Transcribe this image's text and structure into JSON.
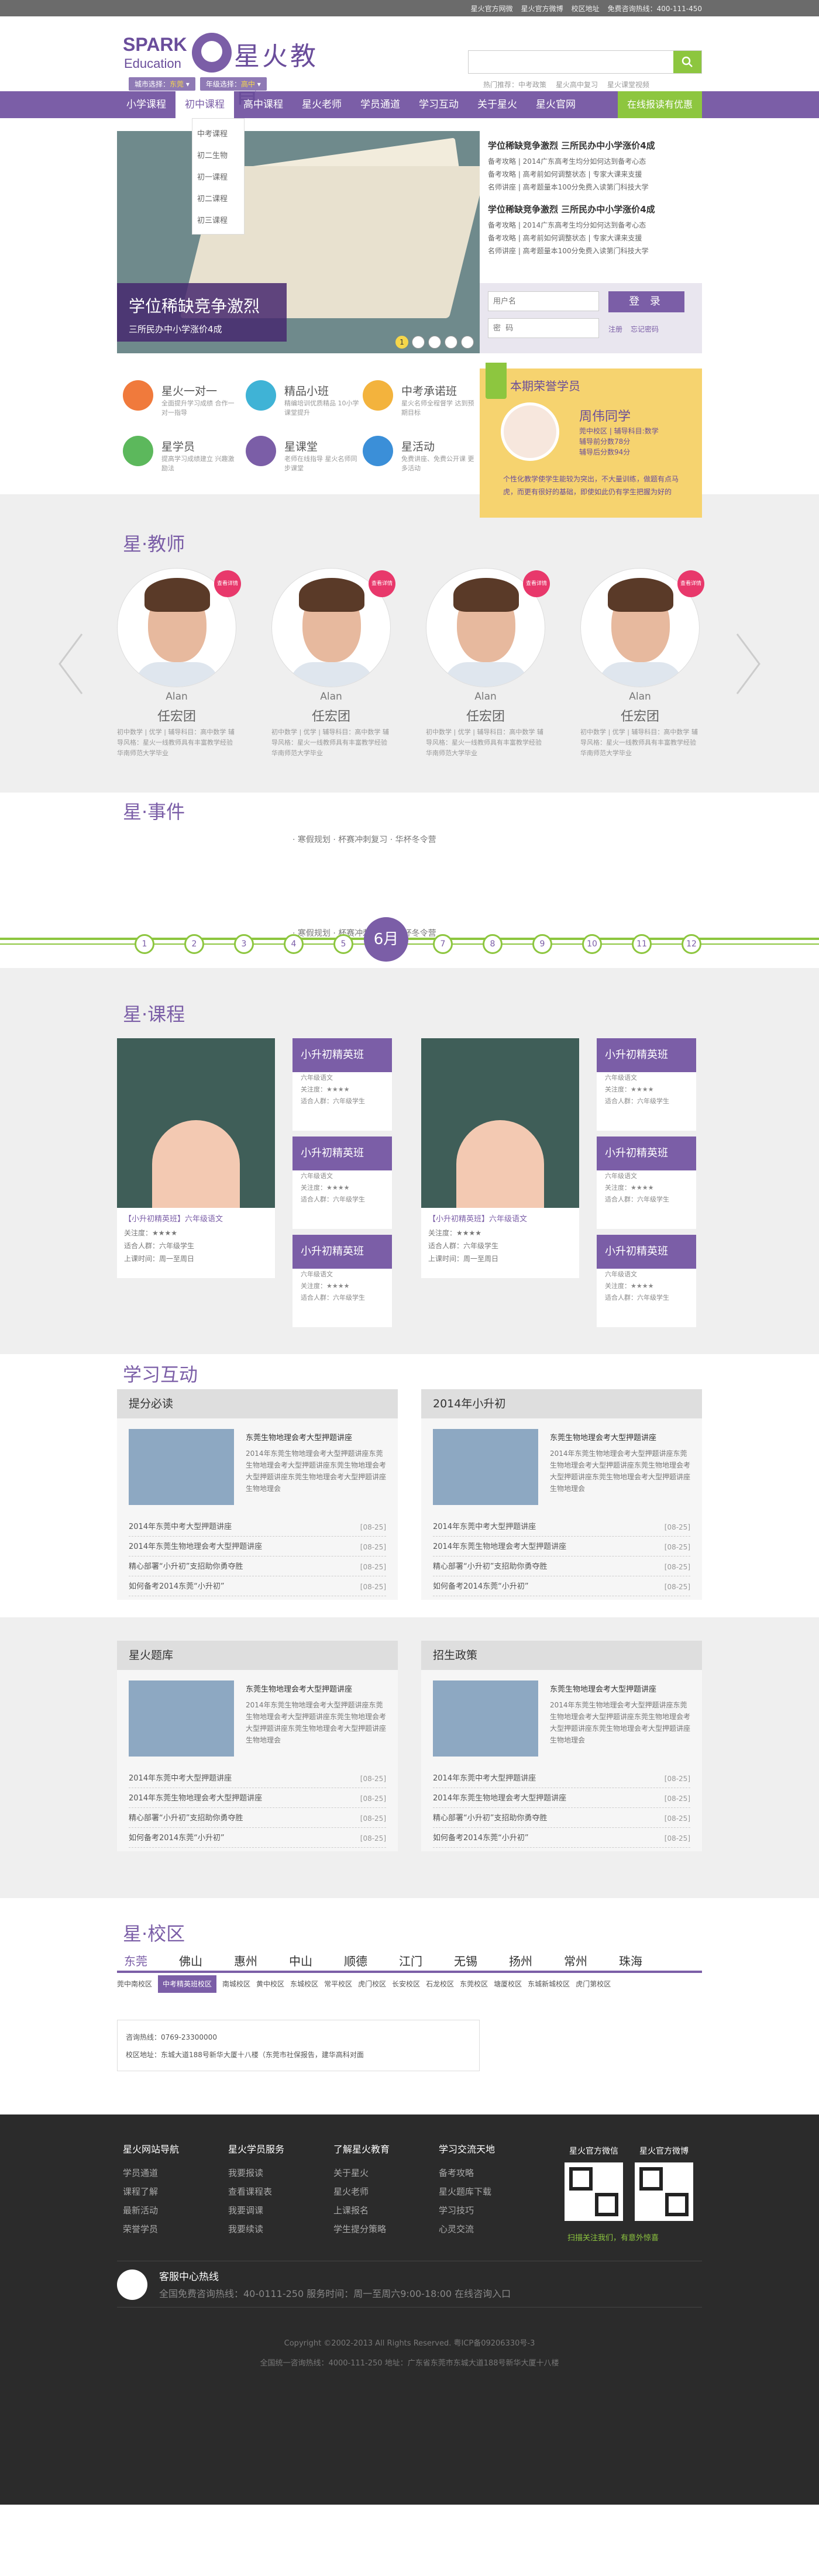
{
  "topbar": {
    "links": [
      "星火官方网微",
      "星火官方微博",
      "校区地址",
      "免费咨询热线：400-111-450"
    ]
  },
  "logo": {
    "en_line1": "SPARK",
    "en_line2": "Education",
    "cn": "星火教育"
  },
  "city": {
    "label1": "城市选择：",
    "value1": "东莞",
    "label2": "年级选择：",
    "value2": "高中"
  },
  "search": {
    "placeholder": "",
    "hot": [
      "热门推荐：中考政策",
      "星火高中复习",
      "星火课堂视频"
    ]
  },
  "nav": {
    "items": [
      "小学课程",
      "初中课程",
      "高中课程",
      "星火老师",
      "学员通道",
      "学习互动",
      "关于星火",
      "星火官网"
    ],
    "cta": "在线报读有优惠"
  },
  "dropdown": [
    "中考课程",
    "初二生物",
    "初一课程",
    "初二课程",
    "初三课程"
  ],
  "banner": {
    "cap_title": "学位稀缺竞争激烈",
    "cap_sub": "三所民办中小学涨价4成",
    "dots": [
      "1",
      "",
      "",
      "",
      ""
    ]
  },
  "news": [
    {
      "title": "学位稀缺竞争激烈 三所民办中小学涨价4成",
      "lines": [
        "备考攻略 | 2014广东高考生均分如何达到备考心态",
        "备考攻略 | 高考前如何调整状态 | 专家大课来支援",
        "名师讲座 | 高考题量本100分免费入读第门科技大学"
      ]
    },
    {
      "title": "学位稀缺竞争激烈 三所民办中小学涨价4成",
      "lines": [
        "备考攻略 | 2014广东高考生均分如何达到备考心态",
        "备考攻略 | 高考前如何调整状态 | 专家大课来支援",
        "名师讲座 | 高考题量本100分免费入读第门科技大学"
      ]
    }
  ],
  "login": {
    "user_placeholder": "用户名",
    "pass_placeholder": "密  码",
    "btn": "登 录",
    "register": "注册",
    "forgot": "忘记密码"
  },
  "services": [
    {
      "title": "星火一对一",
      "sub": "全面提升学习成绩\n合作一对一指导",
      "color": "#f07a3c"
    },
    {
      "title": "精品小班",
      "sub": "精编培训优质精品\n10小学课堂提升",
      "color": "#3fb3d6"
    },
    {
      "title": "中考承诺班",
      "sub": "星火名师全程督学\n达到预期目标",
      "color": "#f3b33d"
    },
    {
      "title": "星学员",
      "sub": "提高学习成绩建立\n兴趣激励法",
      "color": "#5cb85c"
    },
    {
      "title": "星课堂",
      "sub": "老师在线指导\n星火名师同步课堂",
      "color": "#7b5ea7"
    },
    {
      "title": "星活动",
      "sub": "免费讲座、免费公开课\n更多活动",
      "color": "#3b8fd8"
    }
  ],
  "star": {
    "head": "本期荣誉学员",
    "name": "周伟同学",
    "info": [
      "莞中校区 | 辅导科目:数学",
      "辅导前分数78分",
      "辅导后分数94分"
    ],
    "desc": "个性化教学使学生能较为突出，不大量训练，做题有点马虎，而更有很好的基础，即使如此仍有学生把握为好的"
  },
  "teachers": {
    "title": "星·教师",
    "list": [
      {
        "badge": "查看详情",
        "en": "Alan",
        "cn": "任宏团",
        "desc": "初中数学 | 优学 | 辅导科目：高中数学 辅导风格：星火一线教师具有丰富教学经验 华南师范大学毕业"
      },
      {
        "badge": "查看详情",
        "en": "Alan",
        "cn": "任宏团",
        "desc": "初中数学 | 优学 | 辅导科目：高中数学 辅导风格：星火一线教师具有丰富教学经验 华南师范大学毕业"
      },
      {
        "badge": "查看详情",
        "en": "Alan",
        "cn": "任宏团",
        "desc": "初中数学 | 优学 | 辅导科目：高中数学 辅导风格：星火一线教师具有丰富教学经验 华南师范大学毕业"
      },
      {
        "badge": "查看详情",
        "en": "Alan",
        "cn": "任宏团",
        "desc": "初中数学 | 优学 | 辅导科目：高中数学 辅导风格：星火一线教师具有丰富教学经验 华南师范大学毕业"
      }
    ]
  },
  "events": {
    "title": "星·事件",
    "top": "· 寒假规划 · 杯赛冲刺复习 · 华杯冬令营",
    "bottom": "· 寒假规划 · 杯赛冲刺复习 · 华杯冬令营",
    "months": [
      "1",
      "2",
      "3",
      "4",
      "5",
      "7",
      "8",
      "9",
      "10",
      "11",
      "12"
    ],
    "current": "6月"
  },
  "courses": {
    "title": "星·课程",
    "big": {
      "title": "【小升初精英班】六年级语文",
      "lines": [
        "关注度：★★★★",
        "适合人群：六年级学生",
        "上课时间：周一至周日"
      ]
    },
    "small": {
      "head": "小升初精英班",
      "lines": [
        "六年级语文",
        "关注度：★★★★",
        "适合人群：六年级学生"
      ]
    }
  },
  "interact": {
    "title": "学习互动",
    "boxes": [
      {
        "head": "提分必读",
        "pt": "东莞生物地理会考大型押题讲座",
        "pd": "2014年东莞生物地理会考大型押题讲座东莞生物地理会考大型押题讲座东莞生物地理会考大型押题讲座东莞生物地理会考大型押题讲座生物地理会",
        "list": [
          "2014年东莞中考大型押题讲座",
          "2014年东莞生物地理会考大型押题讲座",
          "精心部署“小升初”支招助你勇夺胜",
          "如何备考2014东莞“小升初”"
        ],
        "date": "[08-25]"
      },
      {
        "head": "2014年小升初",
        "pt": "东莞生物地理会考大型押题讲座",
        "pd": "2014年东莞生物地理会考大型押题讲座东莞生物地理会考大型押题讲座东莞生物地理会考大型押题讲座东莞生物地理会考大型押题讲座生物地理会",
        "list": [
          "2014年东莞中考大型押题讲座",
          "2014年东莞生物地理会考大型押题讲座",
          "精心部署“小升初”支招助你勇夺胜",
          "如何备考2014东莞“小升初”"
        ],
        "date": "[08-25]"
      },
      {
        "head": "星火题库",
        "pt": "东莞生物地理会考大型押题讲座",
        "pd": "2014年东莞生物地理会考大型押题讲座东莞生物地理会考大型押题讲座东莞生物地理会考大型押题讲座东莞生物地理会考大型押题讲座生物地理会",
        "list": [
          "2014年东莞中考大型押题讲座",
          "2014年东莞生物地理会考大型押题讲座",
          "精心部署“小升初”支招助你勇夺胜",
          "如何备考2014东莞“小升初”"
        ],
        "date": "[08-25]"
      },
      {
        "head": "招生政策",
        "pt": "东莞生物地理会考大型押题讲座",
        "pd": "2014年东莞生物地理会考大型押题讲座东莞生物地理会考大型押题讲座东莞生物地理会考大型押题讲座东莞生物地理会考大型押题讲座生物地理会",
        "list": [
          "2014年东莞中考大型押题讲座",
          "2014年东莞生物地理会考大型押题讲座",
          "精心部署“小升初”支招助你勇夺胜",
          "如何备考2014东莞“小升初”"
        ],
        "date": "[08-25]"
      }
    ]
  },
  "campus": {
    "title": "星·校区",
    "tabs": [
      "东莞",
      "佛山",
      "惠州",
      "中山",
      "顺德",
      "江门",
      "无锡",
      "扬州",
      "常州",
      "珠海"
    ],
    "subs": [
      "莞中南校区",
      "中考精英班校区",
      "南城校区",
      "黄中校区",
      "东城校区",
      "常平校区",
      "虎门校区",
      "长安校区",
      "石龙校区",
      "东莞校区",
      "塘厦校区",
      "东城新城校区",
      "虎门第校区"
    ],
    "phone": "咨询热线：0769-23300000",
    "addr": "校区地址：东城大道188号新华大厦十八楼（东莞市社保报告，建华高科对面"
  },
  "footer": {
    "cols": [
      {
        "h": "星火网站导航",
        "items": [
          "学员通道",
          "课程了解",
          "最新活动",
          "荣誉学员"
        ]
      },
      {
        "h": "星火学员服务",
        "items": [
          "我要报读",
          "查看课程表",
          "我要调课",
          "我要续读"
        ]
      },
      {
        "h": "了解星火教育",
        "items": [
          "关于星火",
          "星火老师",
          "上课报名",
          "学生提分策略"
        ]
      },
      {
        "h": "学习交流天地",
        "items": [
          "备考攻略",
          "星火题库下载",
          "学习技巧",
          "心灵交流"
        ]
      }
    ],
    "qr": [
      {
        "h": "星火官方微信"
      },
      {
        "h": "星火官方微博"
      }
    ],
    "qr_note": "扫描关注我们，有意外惊喜",
    "hotline_title": "客服中心热线",
    "hotline_sub": "全国免费咨询热线：40-0111-250      服务时间：周一至周六9:00-18:00      在线咨询入口",
    "copy1": "Copyright ©2002-2013 All Rights Reserved. 粤ICP备09206330号-3",
    "copy2": "全国统一咨询热线：4000-111-250   地址：广东省东莞市东城大道188号新华大厦十八楼"
  }
}
